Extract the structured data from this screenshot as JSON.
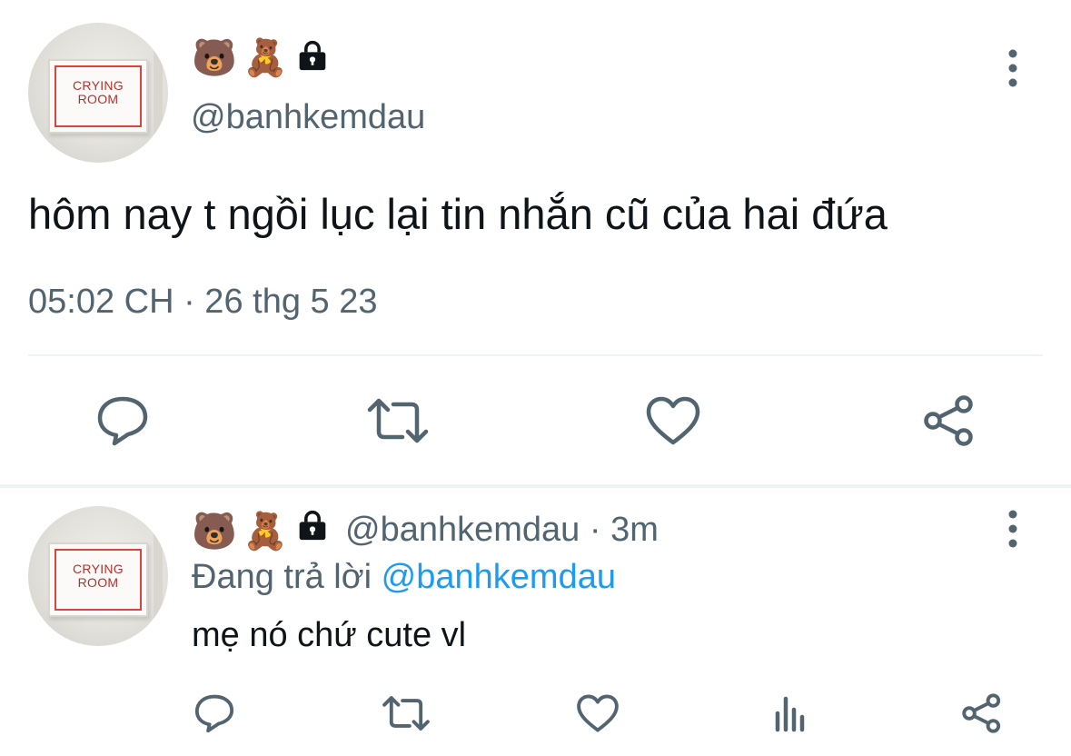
{
  "main_tweet": {
    "avatar_sign_line1": "CRYING",
    "avatar_sign_line2": "ROOM",
    "name_emojis": [
      "🐻",
      "🧸"
    ],
    "handle": "@banhkemdau",
    "text": "hôm nay t ngồi lục lại tin nhắn cũ của hai đứa",
    "timestamp": "05:02 CH · 26 thg 5 23",
    "actions": [
      "reply-icon",
      "retweet-icon",
      "like-icon",
      "share-icon"
    ]
  },
  "reply_tweet": {
    "avatar_sign_line1": "CRYING",
    "avatar_sign_line2": "ROOM",
    "name_emojis": [
      "🐻",
      "🧸"
    ],
    "handle_time": "@banhkemdau · 3m",
    "replying_prefix": "Đang trả lời ",
    "replying_to": "@banhkemdau",
    "text": "mẹ nó chứ cute vl",
    "actions": [
      "reply-icon",
      "retweet-icon",
      "like-icon",
      "views-icon",
      "share-icon"
    ]
  },
  "colors": {
    "text_primary": "#0f1419",
    "text_secondary": "#536471",
    "link": "#1d9bf0",
    "icon": "#536471",
    "divider": "#eff3f4",
    "sign_red": "#d9453f"
  }
}
